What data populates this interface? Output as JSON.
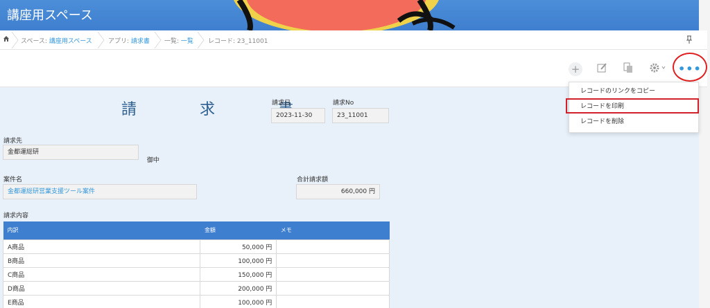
{
  "header": {
    "title": "講座用スペース"
  },
  "breadcrumb": {
    "space_prefix": "スペース: ",
    "space_name": "講座用スペース",
    "app_prefix": "アプリ: ",
    "app_name": "請求書",
    "list_prefix": "一覧: ",
    "list_name": "一覧",
    "record": "レコード: 23_11001"
  },
  "toolbar": {
    "more_label": "•••"
  },
  "menu": {
    "items": [
      "レコードのリンクをコピー",
      "レコードを印刷",
      "レコードを削除"
    ]
  },
  "form": {
    "title": "請 求 書",
    "invoice_date_label": "請求日",
    "invoice_date": "2023-11-30",
    "invoice_no_label": "請求No",
    "invoice_no": "23_11001",
    "billto_label": "請求先",
    "billto": "金都運総研",
    "billto_suffix": "御中",
    "project_label": "案件名",
    "project": "金都運総研営業支援ツール案件",
    "total_label": "合計請求額",
    "total": "660,000 円",
    "details_label": "請求内容"
  },
  "table": {
    "headers": [
      "内訳",
      "金額",
      "メモ"
    ],
    "rows": [
      {
        "item": "A商品",
        "amount": "50,000 円",
        "memo": ""
      },
      {
        "item": "B商品",
        "amount": "100,000 円",
        "memo": ""
      },
      {
        "item": "C商品",
        "amount": "150,000 円",
        "memo": ""
      },
      {
        "item": "D商品",
        "amount": "200,000 円",
        "memo": ""
      },
      {
        "item": "E商品",
        "amount": "100,000 円",
        "memo": ""
      }
    ]
  },
  "colors": {
    "accent": "#3f7fcf",
    "link": "#3498db",
    "highlight": "#e02020"
  }
}
